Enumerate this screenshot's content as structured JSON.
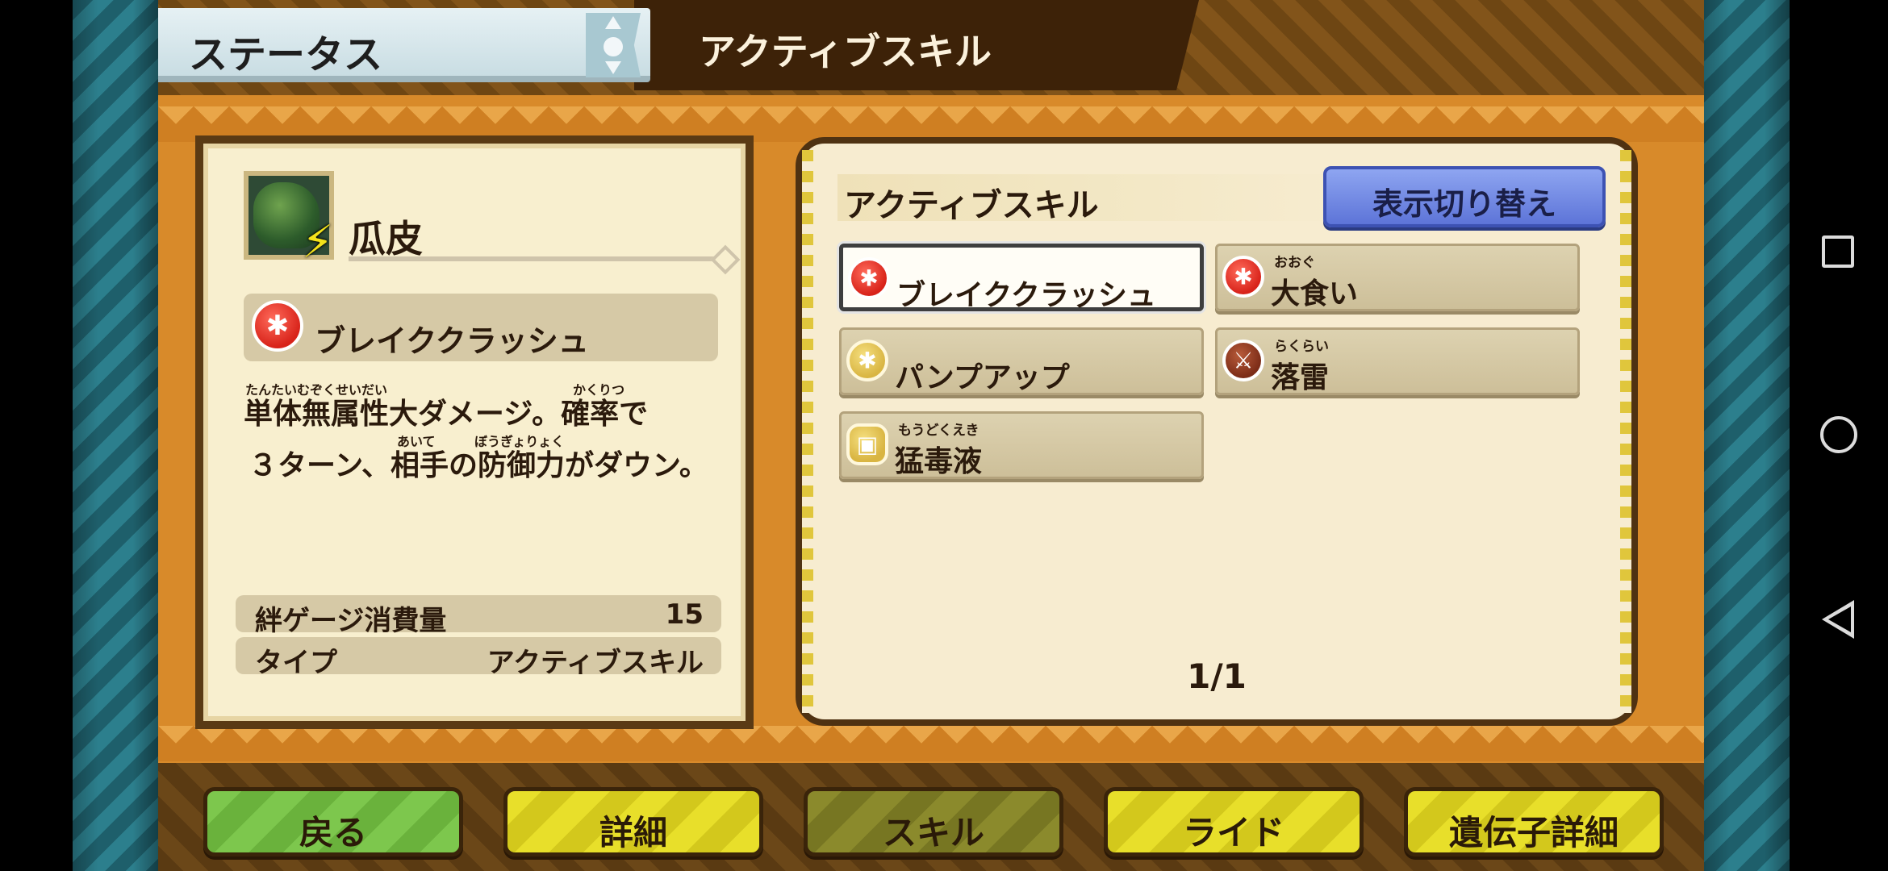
{
  "header": {
    "status_tab_label": "ステータス",
    "active_tab_title": "アクティブスキル"
  },
  "monster": {
    "name": "瓜皮",
    "thumb_icon": "monster-portrait",
    "element_icon": "thunder-bolt-icon"
  },
  "selected_skill": {
    "name": "ブレイククラッシュ",
    "icon": "power-figure-icon",
    "description_line1": "単体無属性大ダメージ。確率で",
    "description_line2": "３ターン、相手の防御力がダウン。",
    "ruby": {
      "tantai": "たんたいむぞくせいだい",
      "kakuritsu": "かくりつ",
      "aite": "あいて",
      "bougyoryoku": "ぼうぎょりょく"
    },
    "info": [
      {
        "key": "絆ゲージ消費量",
        "value": "15"
      },
      {
        "key": "タイプ",
        "value": "アクティブスキル"
      }
    ]
  },
  "skill_panel": {
    "label": "アクティブスキル",
    "toggle_button": "表示切り替え",
    "skills": [
      {
        "name": "ブレイククラッシュ",
        "ruby": "",
        "icon": "power-figure-icon",
        "color": "#d8231a",
        "selected": true
      },
      {
        "name": "大食い",
        "ruby": "おおぐ",
        "icon": "power-figure-icon",
        "color": "#d8231a",
        "selected": false
      },
      {
        "name": "パンプアップ",
        "ruby": "",
        "icon": "pump-up-icon",
        "color": "#d9b542",
        "selected": false
      },
      {
        "name": "落雷",
        "ruby": "らくらい",
        "icon": "lightning-sword-icon",
        "color": "#7c2c17",
        "selected": false
      },
      {
        "name": "猛毒液",
        "ruby": "もうどくえき",
        "icon": "shield-icon",
        "color": "#d9b542",
        "selected": false
      }
    ],
    "page_indicator": "1/1"
  },
  "bottom_nav": {
    "back": "戻る",
    "detail": "詳細",
    "skill": "スキル",
    "ride": "ライド",
    "gene_detail": "遺伝子詳細"
  }
}
